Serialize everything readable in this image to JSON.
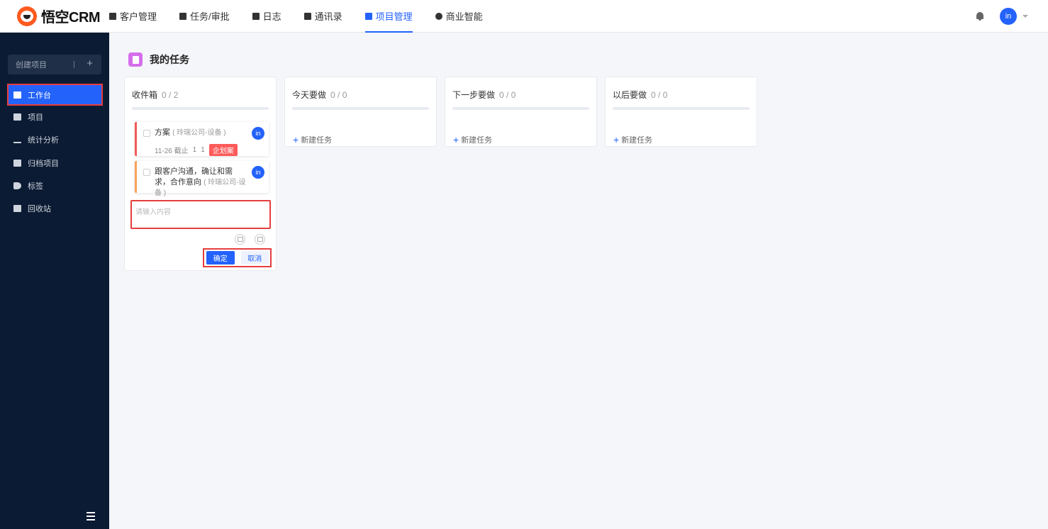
{
  "app": {
    "name": "悟空CRM"
  },
  "nav": {
    "items": [
      {
        "label": "客户管理"
      },
      {
        "label": "任务/审批"
      },
      {
        "label": "日志"
      },
      {
        "label": "通讯录"
      },
      {
        "label": "项目管理",
        "active": true
      },
      {
        "label": "商业智能"
      }
    ]
  },
  "user": {
    "avatar_text": "in"
  },
  "sidebar": {
    "create_label": "创建项目",
    "create_plus": "+",
    "items": [
      {
        "label": "工作台",
        "icon": "monitor-icon",
        "active": true
      },
      {
        "label": "项目",
        "icon": "list-icon"
      },
      {
        "label": "统计分析",
        "icon": "bar-chart-icon"
      },
      {
        "label": "归档项目",
        "icon": "archive-icon"
      },
      {
        "label": "标签",
        "icon": "tag-icon"
      },
      {
        "label": "回收站",
        "icon": "trash-icon"
      }
    ]
  },
  "page": {
    "title": "我的任务"
  },
  "columns": [
    {
      "title": "收件箱",
      "count": "0 / 2"
    },
    {
      "title": "今天要做",
      "count": "0 / 0",
      "new_task": "新建任务"
    },
    {
      "title": "下一步要做",
      "count": "0 / 0",
      "new_task": "新建任务"
    },
    {
      "title": "以后要做",
      "count": "0 / 0",
      "new_task": "新建任务"
    }
  ],
  "tasks": [
    {
      "title": "方案",
      "sub": "( 玲瑞公司-设备 )",
      "due": "11-26 截止",
      "c1": "1",
      "c2": "1",
      "tag": "企划案",
      "avatar": "in",
      "color": "#f05a5a"
    },
    {
      "title": "跟客户沟通，确让和需求，合作意向",
      "sub": "( 玲瑞公司-设备 )",
      "avatar": "in",
      "color": "#f7a25a"
    }
  ],
  "new_task_form": {
    "placeholder": "请输入内容",
    "ok": "确定",
    "cancel": "取消"
  },
  "colors": {
    "accent": "#2362fb",
    "sidebar_bg": "#0b1b33",
    "highlight": "#e53e3e"
  }
}
